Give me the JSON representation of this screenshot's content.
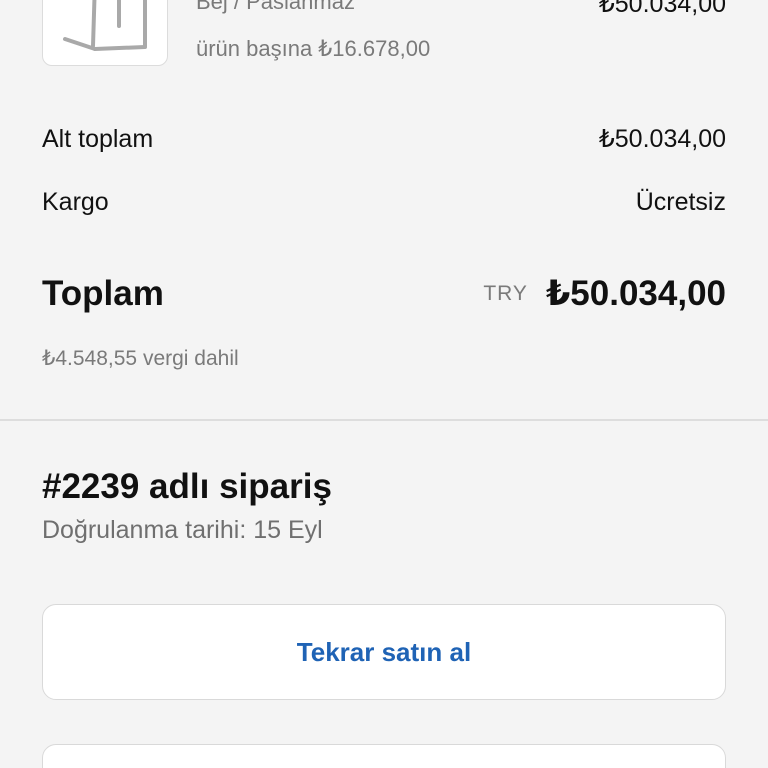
{
  "product": {
    "variant": "Bej / Paslanmaz",
    "unit_price": "ürün başına ₺16.678,00",
    "line_total": "₺50.034,00",
    "thumbnail_icon": "metal-frame-product-image"
  },
  "summary": {
    "subtotal_label": "Alt toplam",
    "subtotal_value": "₺50.034,00",
    "shipping_label": "Kargo",
    "shipping_value": "Ücretsiz",
    "total_label": "Toplam",
    "total_currency": "TRY",
    "total_value": "₺50.034,00",
    "tax_note": "₺4.548,55 vergi dahil"
  },
  "order": {
    "title": "#2239 adlı sipariş",
    "confirmed_date": "Doğrulanma tarihi: 15 Eyl",
    "buy_again_label": "Tekrar satın al"
  },
  "colors": {
    "background": "#f4f4f4",
    "link_blue": "#1f63b5",
    "muted_text": "#7a7a7a"
  }
}
